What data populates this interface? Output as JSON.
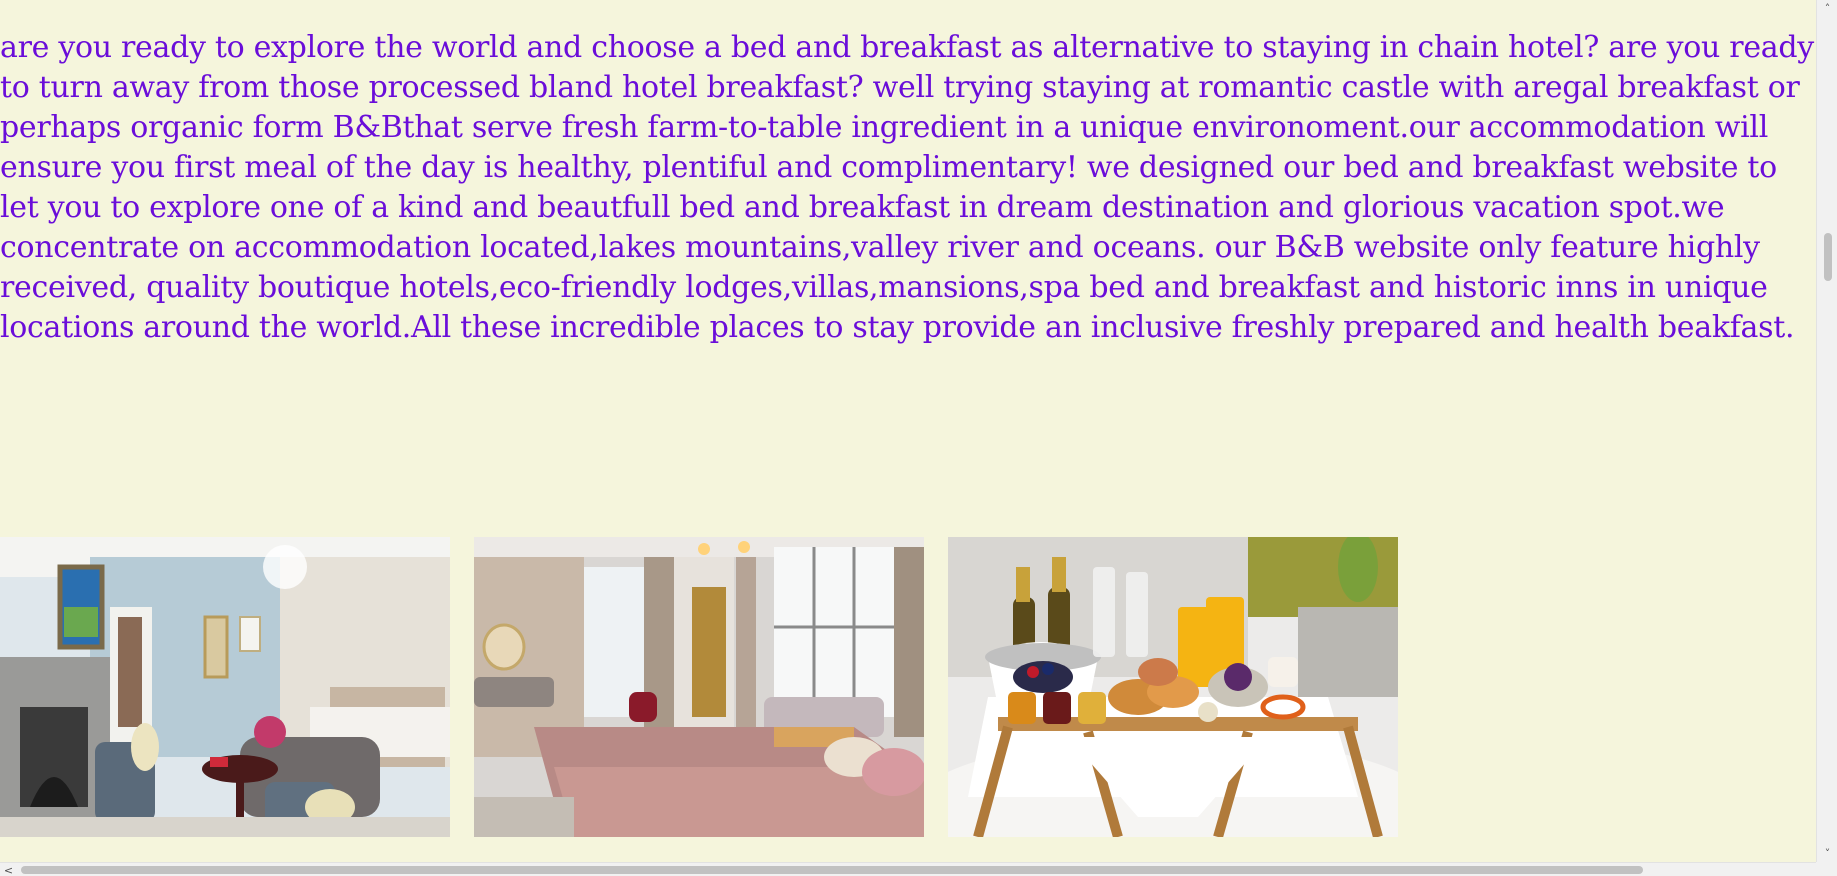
{
  "intro": {
    "text": "are you ready to explore the world and choose a bed and breakfast as alternative to staying in chain hotel? are you ready to turn away from those processed bland hotel breakfast? well trying staying at romantic castle with aregal breakfast or perhaps organic form B&Bthat serve fresh farm-to-table ingredient in a unique environoment.our accommodation will ensure you first meal of the day is healthy, plentiful and complimentary! we designed our bed and breakfast website to let you to explore one of a kind and beautfull bed and breakfast in dream destination and glorious vacation spot.we concentrate on accommodation located,lakes mountains,valley river and oceans. our B&B website only feature highly received, quality boutique hotels,eco-friendly lodges,villas,mansions,spa bed and breakfast and historic inns in unique locations around the world.All these incredible places to stay provide an inclusive freshly prepared and health beakfast."
  },
  "scrollbars": {
    "up_arrow": "˄",
    "down_arrow": "˅",
    "left_arrow": "<",
    "right_arrow": ">"
  },
  "colors": {
    "background": "#f5f5dc",
    "text": "#6a0dd9"
  }
}
